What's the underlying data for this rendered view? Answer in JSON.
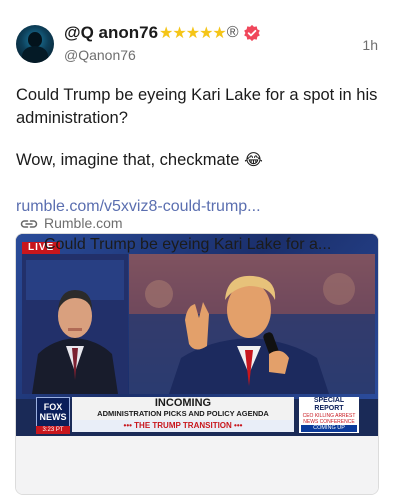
{
  "author": {
    "display_name": "@Q anon76",
    "stars": "★★★★★",
    "registered_mark": "®",
    "handle": "@Qanon76",
    "timestamp": "1h",
    "icons": {
      "avatar": "avatar-icon",
      "verified": "verified-badge-icon"
    },
    "verified_color": "#f0475b"
  },
  "post": {
    "text_line1": "Could Trump be eyeing Kari Lake for a spot in his administration?",
    "text_line2": "Wow, imagine that, checkmate",
    "emoji": "😂",
    "link_text": "rumble.com/v5xviz8-could-trump...",
    "link_color": "#5b6fb0"
  },
  "link_card": {
    "domain": "Rumble.com",
    "title": "Could Trump be eyeing Kari Lake for a...",
    "link_icon": "link-icon",
    "thumbnail": {
      "live_badge": "LIVE",
      "fox_logo": "FOX NEWS",
      "fox_time": "3:23 PT",
      "chyron_line1": "INCOMING",
      "chyron_line2": "ADMINISTRATION PICKS AND POLICY AGENDA",
      "chyron_line3": "••• THE TRUMP TRANSITION •••",
      "special_title": "SPECIAL REPORT",
      "special_sub": "CEO KILLING ARREST NEWS CONFERENCE",
      "special_coming": "COMING UP"
    }
  }
}
